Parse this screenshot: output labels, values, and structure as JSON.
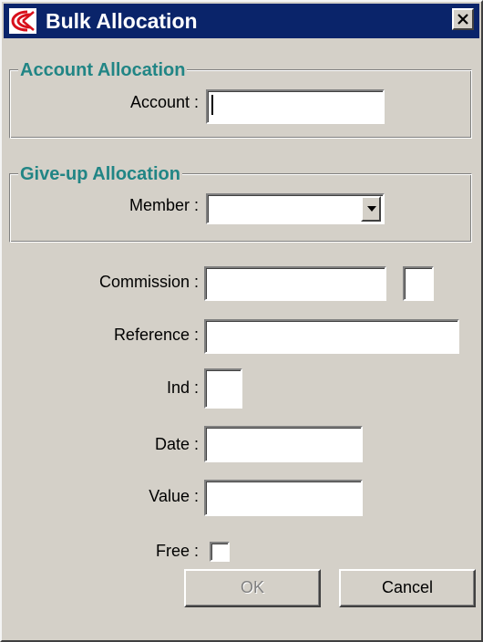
{
  "window": {
    "title": "Bulk Allocation",
    "logo_icon": "app-logo-icon",
    "close_icon": "close-icon"
  },
  "account_allocation": {
    "group_title": "Account Allocation",
    "account_label": "Account :",
    "account_value": ""
  },
  "giveup_allocation": {
    "group_title": "Give-up Allocation",
    "member_label": "Member :",
    "member_value": ""
  },
  "fields": {
    "commission_label": "Commission :",
    "commission_value": "",
    "commission_suffix_value": "",
    "reference_label": "Reference :",
    "reference_value": "",
    "ind_label": "Ind :",
    "ind_value": "",
    "date_label": "Date :",
    "date_value": "",
    "value_label": "Value :",
    "value_value": "",
    "free_label": "Free :",
    "free_checked": false
  },
  "buttons": {
    "ok_label": "OK",
    "ok_enabled": false,
    "cancel_label": "Cancel"
  },
  "colors": {
    "titlebar": "#0a246a",
    "group_title": "#218585",
    "dialog_bg": "#d4d0c8",
    "logo_red": "#d8101c"
  }
}
